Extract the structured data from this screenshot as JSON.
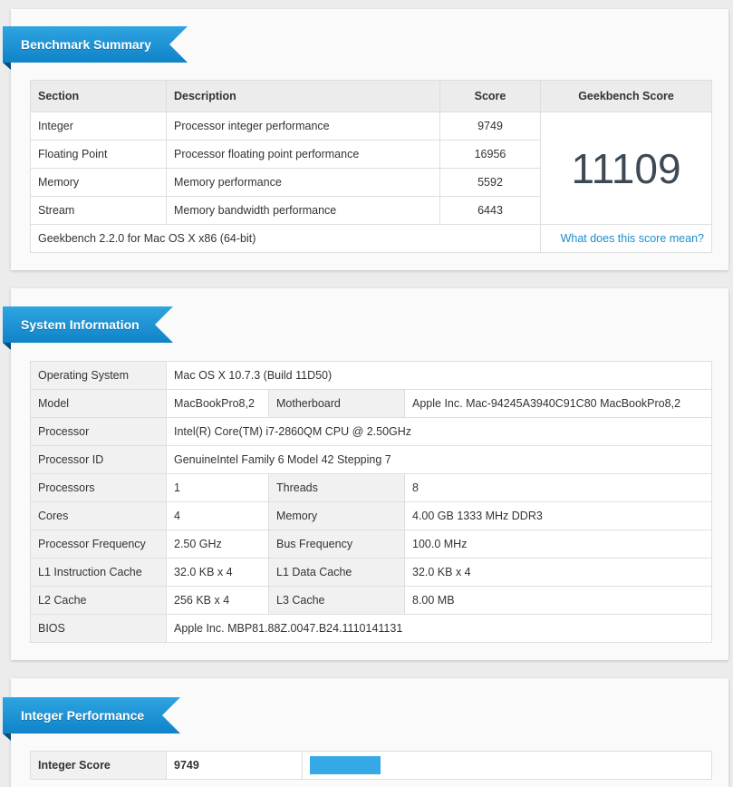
{
  "benchmark_summary": {
    "title": "Benchmark Summary",
    "headers": {
      "section": "Section",
      "description": "Description",
      "score": "Score",
      "geekbench_score": "Geekbench Score"
    },
    "rows": [
      {
        "section": "Integer",
        "description": "Processor integer performance",
        "score": "9749"
      },
      {
        "section": "Floating Point",
        "description": "Processor floating point performance",
        "score": "16956"
      },
      {
        "section": "Memory",
        "description": "Memory performance",
        "score": "5592"
      },
      {
        "section": "Stream",
        "description": "Memory bandwidth performance",
        "score": "6443"
      }
    ],
    "geekbench_score": "11109",
    "version": "Geekbench 2.2.0 for Mac OS X x86 (64-bit)",
    "link": "What does this score mean?"
  },
  "system_information": {
    "title": "System Information",
    "rows": [
      {
        "label": "Operating System",
        "value": "Mac OS X 10.7.3 (Build 11D50)"
      },
      {
        "label": "Model",
        "value": "MacBookPro8,2",
        "label2": "Motherboard",
        "value2": "Apple Inc. Mac-94245A3940C91C80 MacBookPro8,2"
      },
      {
        "label": "Processor",
        "value": "Intel(R) Core(TM) i7-2860QM CPU @ 2.50GHz"
      },
      {
        "label": "Processor ID",
        "value": "GenuineIntel Family 6 Model 42 Stepping 7"
      },
      {
        "label": "Processors",
        "value": "1",
        "label2": "Threads",
        "value2": "8"
      },
      {
        "label": "Cores",
        "value": "4",
        "label2": "Memory",
        "value2": "4.00 GB 1333 MHz DDR3"
      },
      {
        "label": "Processor Frequency",
        "value": "2.50 GHz",
        "label2": "Bus Frequency",
        "value2": "100.0 MHz"
      },
      {
        "label": "L1 Instruction Cache",
        "value": "32.0 KB x 4",
        "label2": "L1 Data Cache",
        "value2": "32.0 KB x 4"
      },
      {
        "label": "L2 Cache",
        "value": "256 KB x 4",
        "label2": "L3 Cache",
        "value2": "8.00 MB"
      },
      {
        "label": "BIOS",
        "value": "Apple Inc. MBP81.88Z.0047.B24.1110141131"
      }
    ]
  },
  "integer_performance": {
    "title": "Integer Performance",
    "score_label": "Integer Score",
    "score": "9749"
  },
  "colors": {
    "ribbon": "#1e95d8",
    "link": "#1a8ed1",
    "bar": "#35a8e6"
  }
}
